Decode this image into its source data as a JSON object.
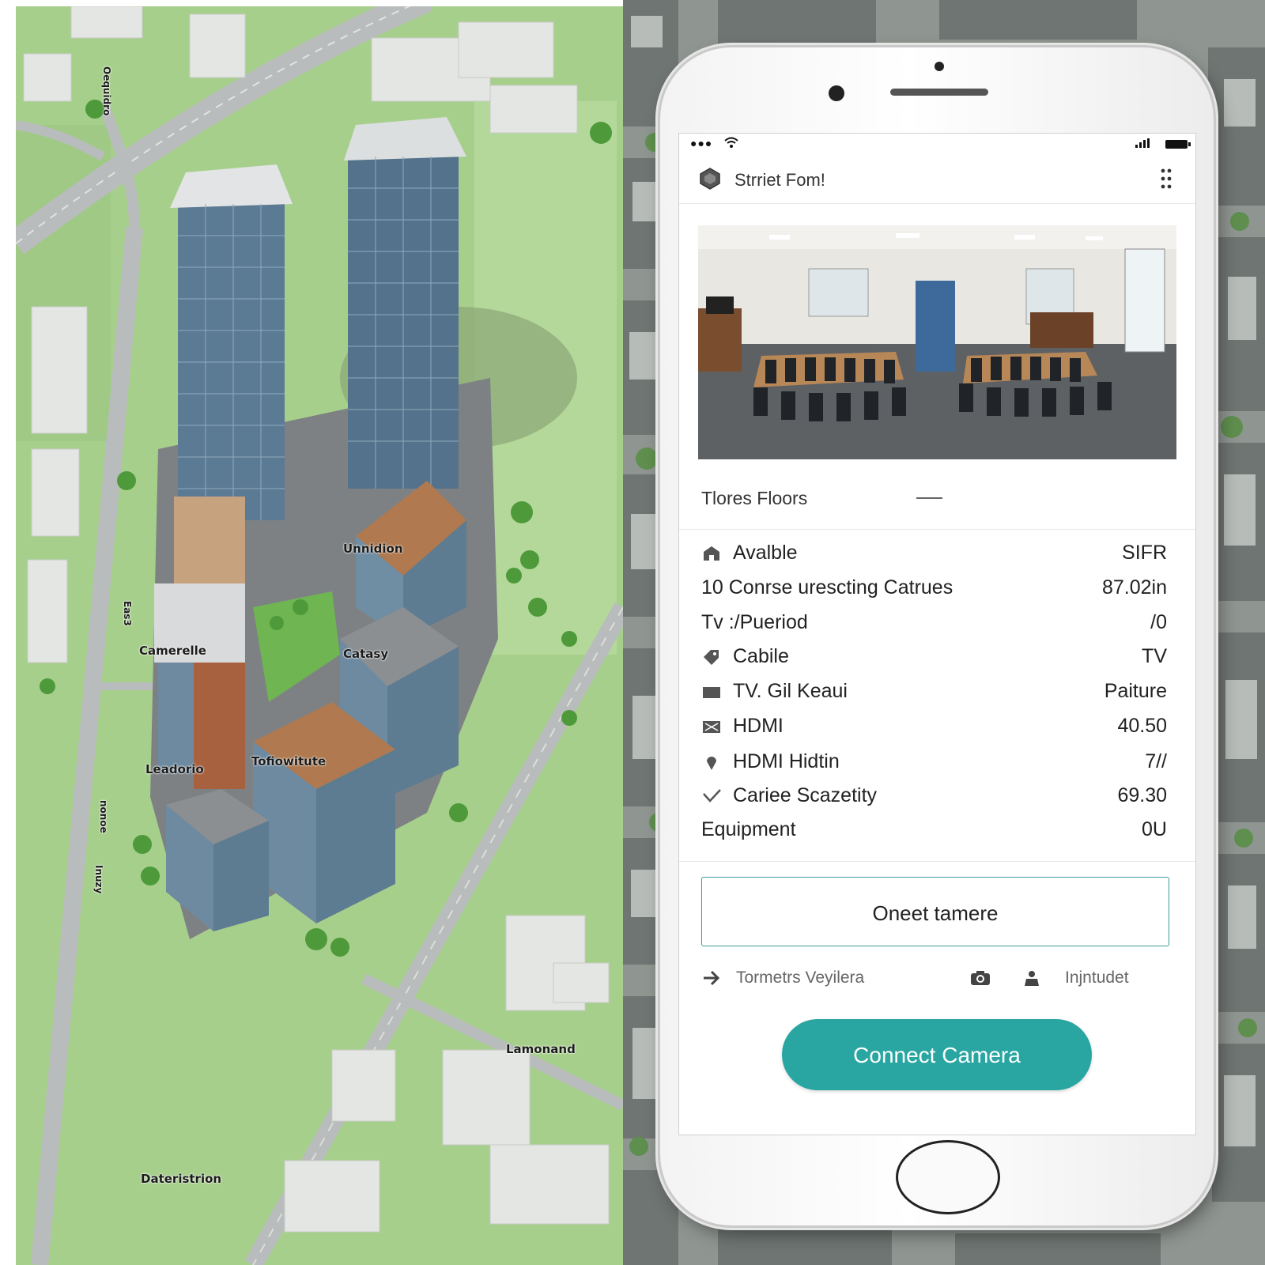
{
  "map": {
    "labels": {
      "top_vertical": "Oequidro",
      "left_vertical": "Eas3",
      "vertical_lower_1": "nonoe",
      "vertical_lower_2": "Inuzy",
      "building_top": "Unnidion",
      "camerelle": "Camerelle",
      "catasy": "Catasy",
      "leadorio": "Leadorio",
      "tofiowitute": "Tofiowitute",
      "lamonand": "Lamonand",
      "dateristrion": "Dateristrion"
    },
    "colors": {
      "grass": "#a7cf8c",
      "road": "#b9bcbc",
      "building_glass": "#5b7a94",
      "roof": "#b0794f"
    }
  },
  "app": {
    "header": {
      "title": "Strriet Fom!",
      "app_icon": "hexagon-icon",
      "menu_icon": "dots-grid-icon"
    },
    "floors": {
      "label": "Tlores Floors"
    },
    "specs": [
      {
        "icon": "home-icon",
        "label": "Avalble",
        "value": "SIFR"
      },
      {
        "icon": "",
        "label": "10 Conrse urescting Catrues",
        "value": "87.02in"
      },
      {
        "icon": "",
        "label": "Tv :/Pueriod",
        "value": "/0"
      },
      {
        "icon": "tag-icon",
        "label": "Cabile",
        "value": "TV"
      },
      {
        "icon": "tv-icon",
        "label": "TV. Gil Keaui",
        "value": "Paiture"
      },
      {
        "icon": "image-icon",
        "label": "HDMI",
        "value": "40.50"
      },
      {
        "icon": "pin-icon",
        "label": "HDMI Hidtin",
        "value": "7//"
      },
      {
        "icon": "check-icon",
        "label": "Cariee Scazetity",
        "value": "69.30"
      },
      {
        "icon": "",
        "label": "Equipment",
        "value": "0U"
      }
    ],
    "outline_button": {
      "label": "Oneet tamere"
    },
    "links": {
      "left_label": "Tormetrs Veyilera",
      "right_label": "Injntudet"
    },
    "connect_button": {
      "label": "Connect Camera"
    },
    "accent_color": "#2aa6a2"
  }
}
